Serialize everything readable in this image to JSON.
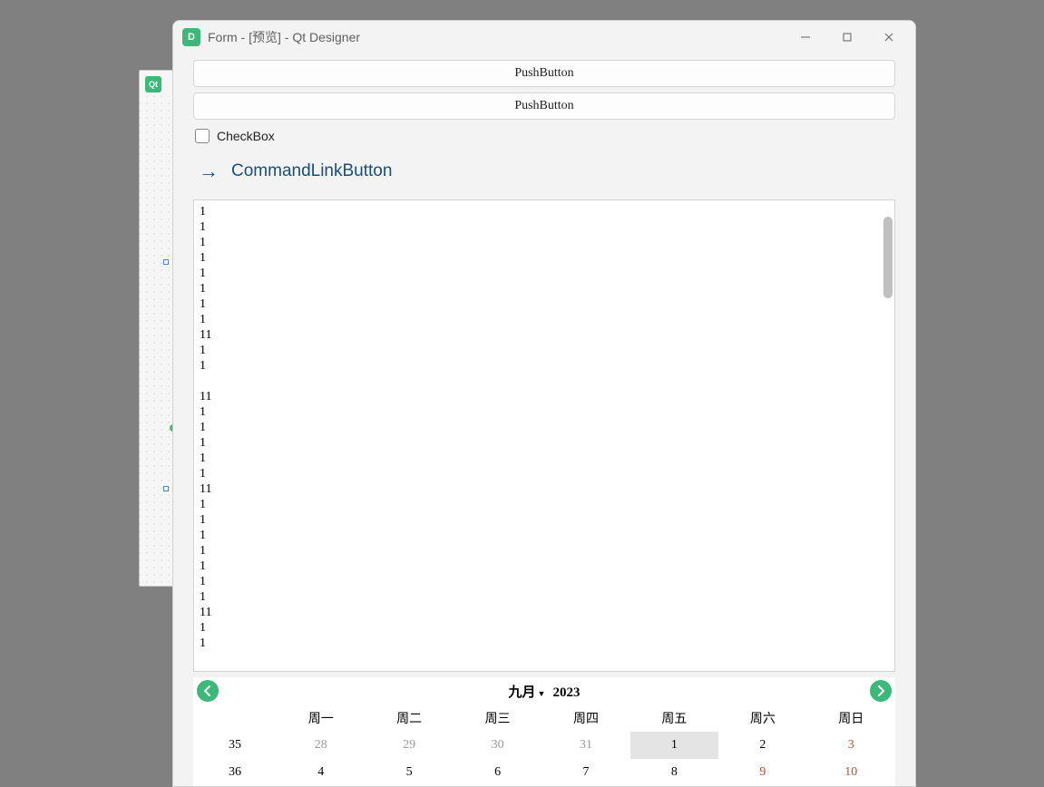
{
  "bg_window": {
    "icon_label": "Qt"
  },
  "window": {
    "icon_label": "D",
    "title": "Form - [预览] - Qt Designer"
  },
  "buttons": {
    "push1": "PushButton",
    "push2": "PushButton"
  },
  "checkbox": {
    "label": "CheckBox"
  },
  "command_link": {
    "label": "CommandLinkButton"
  },
  "textarea": {
    "lines": [
      "1",
      "1",
      "1",
      "1",
      "1",
      "1",
      "1",
      "1",
      "11",
      "1",
      "1",
      "",
      "11",
      "1",
      "1",
      "1",
      "1",
      "1",
      "11",
      "1",
      "1",
      "1",
      "1",
      "1",
      "1",
      "1",
      "11",
      "1",
      "1"
    ]
  },
  "calendar": {
    "month_label": "九月",
    "year_label": "2023",
    "day_headers": [
      "周一",
      "周二",
      "周三",
      "周四",
      "周五",
      "周六",
      "周日"
    ],
    "rows": [
      {
        "week": "35",
        "days": [
          {
            "v": "28",
            "cls": "other-month"
          },
          {
            "v": "29",
            "cls": "other-month"
          },
          {
            "v": "30",
            "cls": "other-month"
          },
          {
            "v": "31",
            "cls": "other-month"
          },
          {
            "v": "1",
            "cls": "selected"
          },
          {
            "v": "2",
            "cls": ""
          },
          {
            "v": "3",
            "cls": "weekend"
          }
        ]
      },
      {
        "week": "36",
        "days": [
          {
            "v": "4",
            "cls": ""
          },
          {
            "v": "5",
            "cls": ""
          },
          {
            "v": "6",
            "cls": ""
          },
          {
            "v": "7",
            "cls": ""
          },
          {
            "v": "8",
            "cls": ""
          },
          {
            "v": "9",
            "cls": "weekend"
          },
          {
            "v": "10",
            "cls": "weekend"
          }
        ]
      }
    ]
  }
}
